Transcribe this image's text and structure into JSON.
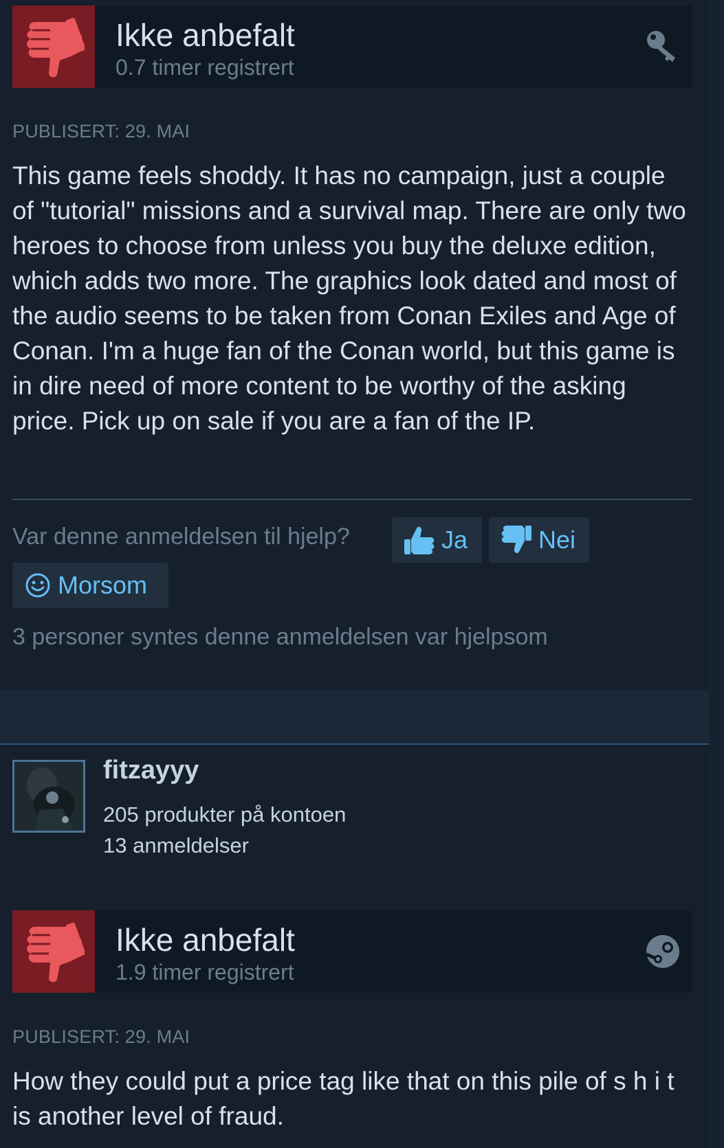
{
  "reviews": [
    {
      "recommendation": "Ikke anbefalt",
      "hours": "0.7 timer registrert",
      "source_icon": "key-icon",
      "posted": "PUBLISERT: 29. MAI",
      "text": "This game feels shoddy. It has no campaign, just a couple of \"tutorial\" missions and a survival map. There are only two heroes to choose from unless you buy the deluxe edition, which adds two more. The graphics look dated and most of the audio seems to be taken from Conan Exiles and Age of Conan. I'm a huge fan of the Conan world, but this game is in dire need of more content to be worthy of the asking price. Pick up on sale if you are a fan of the IP.",
      "helpful_prompt": "Var denne anmeldelsen til hjelp?",
      "yes_label": "Ja",
      "no_label": "Nei",
      "funny_label": "Morsom",
      "helpful_count": "3 personer syntes denne anmeldelsen var hjelpsom"
    },
    {
      "author": {
        "name": "fitzayyy",
        "products": "205 produkter på kontoen",
        "reviews": "13 anmeldelser"
      },
      "recommendation": "Ikke anbefalt",
      "hours": "1.9 timer registrert",
      "source_icon": "steam-icon",
      "posted": "PUBLISERT: 29. MAI",
      "text": "How they could put a price tag like that on this pile of s h i t is another level of fraud."
    }
  ],
  "colors": {
    "background": "#1b2838",
    "review_bg": "#16202d",
    "header_bg": "#0f1923",
    "thumb_down_bg": "#7a1c23",
    "thumb_down_icon": "#e8585c",
    "link_blue": "#66c0f4"
  }
}
